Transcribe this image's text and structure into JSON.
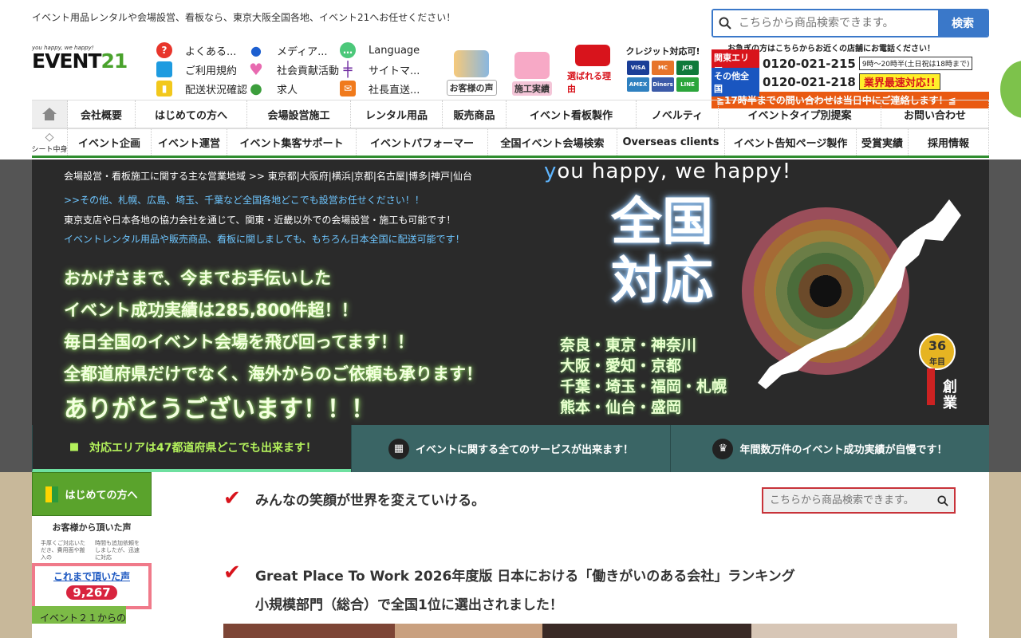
{
  "tagline": "イベント用品レンタルや会場設営、看板なら、東京大阪全国各地、イベント21へお任せください！",
  "search": {
    "placeholder": "こちらから商品検索できます。",
    "button": "検索"
  },
  "logo": {
    "tiny": "you happy, we happy!",
    "text": "EVENT",
    "num": "21"
  },
  "quick_links": [
    {
      "label": "よくある...",
      "icon": "question-icon",
      "color": "#e8352b"
    },
    {
      "label": "メディア...",
      "icon": "microphone-icon",
      "color": "#1d5fd0"
    },
    {
      "label": "Language",
      "icon": "chat-icon",
      "color": "#4cc87a"
    },
    {
      "label": "ご利用規約",
      "icon": "note-icon",
      "color": "#1e9be0"
    },
    {
      "label": "社会貢献活動",
      "icon": "heart-icon",
      "color": "#e86ab0"
    },
    {
      "label": "サイトマ...",
      "icon": "signpost-icon",
      "color": "#6f2ba0"
    },
    {
      "label": "配送状況確認",
      "icon": "truck-icon",
      "color": "#f2c81c"
    },
    {
      "label": "求人",
      "icon": "person-icon",
      "color": "#3c9e3c"
    },
    {
      "label": "社長直送...",
      "icon": "mail-icon",
      "color": "#f07a1c"
    }
  ],
  "badges": [
    {
      "label": "お客様の声",
      "color": "#333",
      "bg": "#fff"
    },
    {
      "label": "施工実績",
      "color": "#333",
      "bg": "#f4c6d8"
    },
    {
      "label": "選ばれる理由",
      "color": "#d8141c",
      "bg": "#fff"
    }
  ],
  "credit": {
    "title": "クレジット対応可!",
    "cards": [
      "VISA",
      "MC",
      "JCB",
      "AMEX",
      "Diners",
      "LINE"
    ]
  },
  "phone": {
    "headline": "お急ぎの方はこちらからお近くの店舗にお電話ください！",
    "kanto_label": "関東エリア",
    "kanto_num": "0120-021-215",
    "hours": "9時〜20時半(土日祝は18時まで)",
    "other_label": "その他全国",
    "other_num": "0120-021-218",
    "fast": "業界最速対応!!",
    "bar": "≧17時半までの問い合わせは当日中にご連絡します！≦"
  },
  "nav1": [
    "会社概要",
    "はじめての方へ",
    "会場設営施工",
    "レンタル用品",
    "販売商品",
    "イベント看板製作",
    "ノベルティ",
    "イベントタイプ別提案",
    "お問い合わせ"
  ],
  "nav2_first": "シート中身",
  "nav2": [
    "イベント企画",
    "イベント運営",
    "イベント集客サポート",
    "イベントパフォーマー",
    "全国イベント会場検索",
    "Overseas clients",
    "イベント告知ページ製作",
    "受賞実績",
    "採用情報"
  ],
  "hero": {
    "area_line": "会場設営・看板施工に関する主な営業地域 >> 東京都|大阪府|横浜|京都|名古屋|博多|神戸|仙台",
    "line2": ">>その他、札幌、広島、埼玉、千葉など全国各地どこでも設営お任せください！！",
    "line3": "東京支店や日本各地の協力会社を通じて、関東・近畿以外での会場設営・施工も可能です！",
    "line4": "イベントレンタル用品や販売商品、看板に関しましても、もちろん日本全国に配送可能です！",
    "big": [
      "おかげさまで、今までお手伝いした",
      "イベント成功実績は285,800件超！！",
      "毎日全国のイベント会場を飛び回ってます！！",
      "全都道府県だけでなく、海外からのご依頼も承ります！",
      "ありがとうございます！！！"
    ],
    "slogan_y": "y",
    "slogan_rest": "ou happy, we happy!",
    "zenkoku": [
      "全国",
      "対応"
    ],
    "cities": [
      "奈良・東京・神奈川",
      "大阪・愛知・京都",
      "千葉・埼玉・福岡・札幌",
      "熊本・仙台・盛岡"
    ],
    "medal_num": "36",
    "medal_unit": "年目",
    "medal_kanji": "創業"
  },
  "tabs": [
    {
      "label": "対応エリアは47都道府県どこでも出来ます！",
      "icon": "truck-icon"
    },
    {
      "label": "イベントに関する全てのサービスが出来ます！",
      "icon": "grid-icon"
    },
    {
      "label": "年間数万件のイベント成功実績が自慢です！",
      "icon": "trophy-icon"
    }
  ],
  "sidebar": {
    "first": "はじめての方へ",
    "voice_head": "お客様から頂いた声",
    "voice_notes": [
      "手厚くご対応いただき、費用面や搬入の",
      "時間も追加依頼をしましたが、迅速に対応"
    ],
    "voices_link": "これまで頂いた声",
    "voices_count": "9,267",
    "from": "イベント２１からの"
  },
  "main": {
    "heading1": "みんなの笑顔が世界を変えていける。",
    "search_placeholder": "こちらから商品検索できます。",
    "heading2_l1": "Great Place To Work 2026年度版 日本における「働きがいのある会社」ランキング",
    "heading2_l2": "小規模部門（総合）で全国1位に選出されました！"
  }
}
